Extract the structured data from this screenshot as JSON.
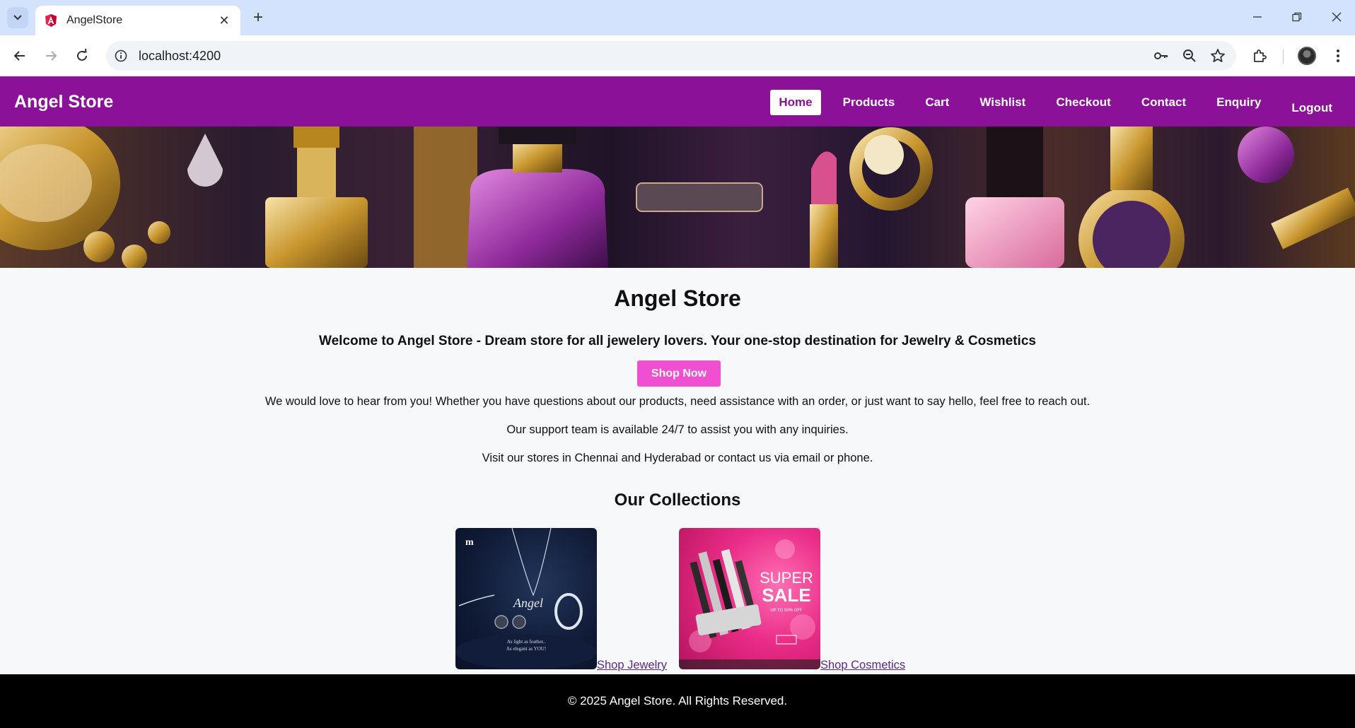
{
  "browser": {
    "tab_title": "AngelStore",
    "url": "localhost:4200"
  },
  "site": {
    "brand": "Angel Store",
    "menu": [
      "Home",
      "Products",
      "Cart",
      "Wishlist",
      "Checkout",
      "Contact",
      "Enquiry"
    ],
    "active_menu": "Home",
    "logout": "Logout"
  },
  "main": {
    "title": "Angel Store",
    "tagline": "Welcome to Angel Store - Dream store for all jewelery lovers. Your one-stop destination for Jewelry & Cosmetics",
    "shop_now": "Shop Now",
    "paragraphs": [
      "We would love to hear from you! Whether you have questions about our products, need assistance with an order, or just want to say hello, feel free to reach out.",
      "Our support team is available 24/7 to assist you with any inquiries.",
      "Visit our stores in Chennai and Hyderabad or contact us via email or phone."
    ],
    "collections_title": "Our Collections",
    "collections": [
      {
        "link": "Shop Jewelry",
        "image_text": "As light as feather.. As elegant as YOU!",
        "image_brand": "Angel"
      },
      {
        "link": "Shop Cosmetics",
        "image_text_1": "SUPER",
        "image_text_2": "SALE",
        "image_text_3": "UP TO 50% OFF"
      }
    ]
  },
  "footer": {
    "text": "© 2025 Angel Store. All Rights Reserved."
  },
  "colors": {
    "nav_bg": "#8b1199",
    "button_bg": "#f04fd2",
    "footer_bg": "#000000",
    "link": "#5b2a86"
  }
}
